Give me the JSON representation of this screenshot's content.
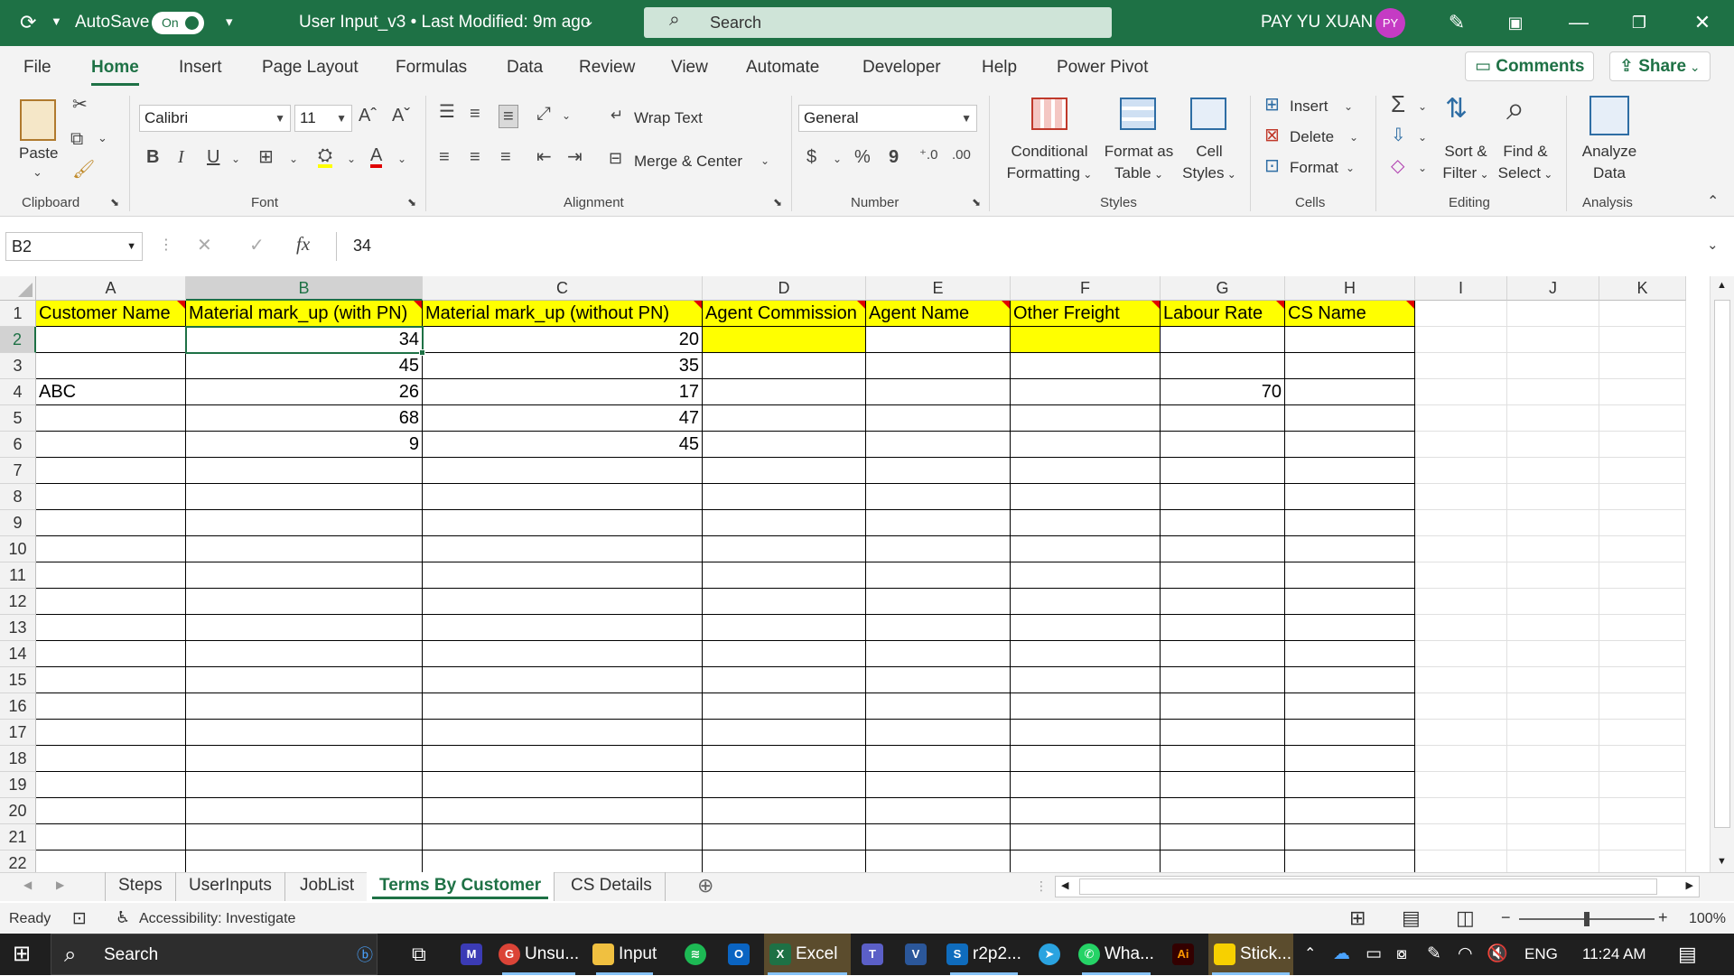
{
  "titlebar": {
    "autosave_label": "AutoSave",
    "autosave_state": "On",
    "filename": "User Input_v3 • Last Modified: 9m ago",
    "search_placeholder": "Search",
    "user_name": "PAY YU XUAN",
    "user_initials": "PY"
  },
  "menu": {
    "tabs": [
      "File",
      "Home",
      "Insert",
      "Page Layout",
      "Formulas",
      "Data",
      "Review",
      "View",
      "Automate",
      "Developer",
      "Help",
      "Power Pivot"
    ],
    "active_tab": "Home",
    "comments_label": "Comments",
    "share_label": "Share"
  },
  "ribbon": {
    "clipboard": {
      "paste_label": "Paste",
      "group_label": "Clipboard"
    },
    "font": {
      "font_name": "Calibri",
      "font_size": "11",
      "bold": "B",
      "italic": "I",
      "underline": "U",
      "group_label": "Font"
    },
    "alignment": {
      "wrap_text": "Wrap Text",
      "merge_center": "Merge & Center",
      "group_label": "Alignment"
    },
    "number": {
      "format": "General",
      "currency": "$",
      "percent": "%",
      "comma": "9",
      "group_label": "Number"
    },
    "styles": {
      "conditional_formatting_1": "Conditional",
      "conditional_formatting_2": "Formatting",
      "format_as_table_1": "Format as",
      "format_as_table_2": "Table",
      "cell_styles_1": "Cell",
      "cell_styles_2": "Styles",
      "group_label": "Styles"
    },
    "cells": {
      "insert": "Insert",
      "delete": "Delete",
      "format": "Format",
      "group_label": "Cells"
    },
    "editing": {
      "sort_filter_1": "Sort &",
      "sort_filter_2": "Filter",
      "find_select_1": "Find &",
      "find_select_2": "Select",
      "group_label": "Editing"
    },
    "analysis": {
      "analyze_1": "Analyze",
      "analyze_2": "Data",
      "group_label": "Analysis"
    }
  },
  "formula_bar": {
    "name_box": "B2",
    "fx": "fx",
    "value": "34"
  },
  "sheet": {
    "columns": [
      "A",
      "B",
      "C",
      "D",
      "E",
      "F",
      "G",
      "H",
      "I",
      "J",
      "K"
    ],
    "selected_column": "B",
    "selected_row": "2",
    "rows": [
      "1",
      "2",
      "3",
      "4",
      "5",
      "6",
      "7",
      "8",
      "9",
      "10",
      "11",
      "12",
      "13",
      "14",
      "15",
      "16",
      "17",
      "18",
      "19",
      "20",
      "21",
      "22"
    ],
    "headers": [
      "Customer Name",
      "Material mark_up (with PN)",
      "Material mark_up (without PN)",
      "Agent Commission",
      "Agent Name",
      "Other Freight",
      "Labour Rate",
      "CS Name"
    ],
    "data": [
      [
        "",
        "34",
        "20",
        "",
        "",
        "",
        "",
        ""
      ],
      [
        "",
        "45",
        "35",
        "",
        "",
        "",
        "",
        ""
      ],
      [
        "ABC",
        "26",
        "17",
        "",
        "",
        "",
        "70",
        ""
      ],
      [
        "",
        "68",
        "47",
        "",
        "",
        "",
        "",
        ""
      ],
      [
        "",
        "9",
        "45",
        "",
        "",
        "",
        "",
        ""
      ]
    ]
  },
  "sheet_tabs": {
    "tabs": [
      "Steps",
      "UserInputs",
      "JobList",
      "Terms By Customer",
      "CS Details"
    ],
    "active": "Terms By Customer"
  },
  "status": {
    "ready": "Ready",
    "accessibility": "Accessibility: Investigate",
    "zoom": "100%"
  },
  "taskbar": {
    "search": "Search",
    "items": [
      "Unsu...",
      "Input",
      "Excel",
      "r2p2...",
      "Wha...",
      "Stick..."
    ],
    "language": "ENG",
    "time": "11:24 AM"
  },
  "colors": {
    "excel_green": "#1e7145",
    "header_fill": "#ffff00",
    "comment_marker": "#e00000"
  }
}
